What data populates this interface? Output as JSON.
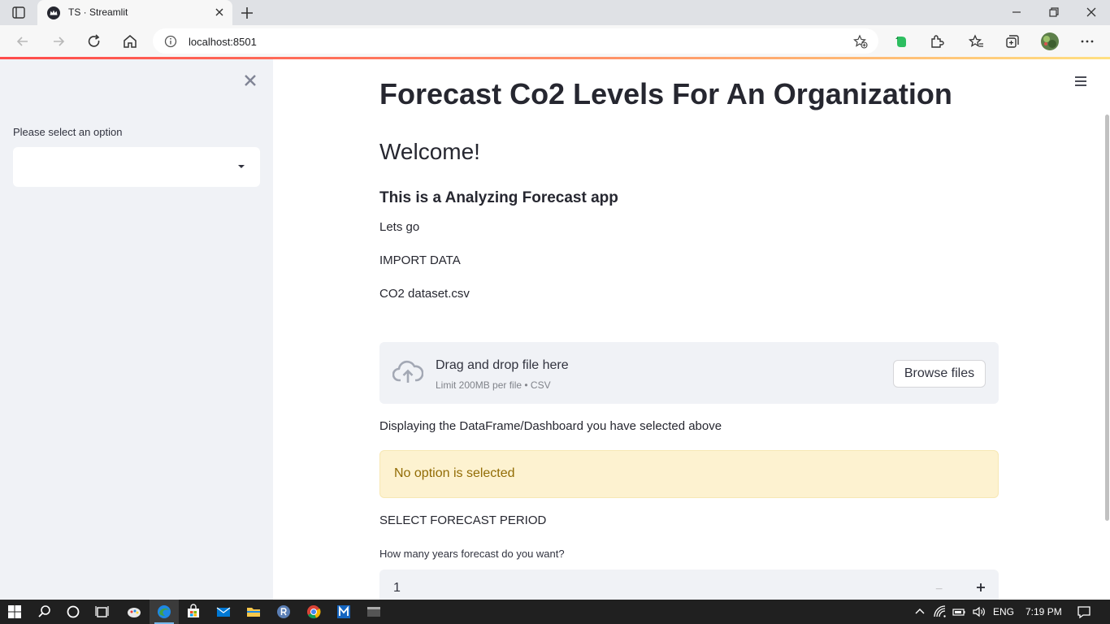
{
  "browser": {
    "tab_title": "TS · Streamlit",
    "url": "localhost:8501"
  },
  "sidebar": {
    "select_label": "Please select an option",
    "select_value": ""
  },
  "main": {
    "title": "Forecast Co2 Levels For An Organization",
    "welcome": "Welcome!",
    "subtitle": "This is a Analyzing Forecast app",
    "lets_go": "Lets go",
    "import_data": "IMPORT DATA",
    "dataset_name": "CO2 dataset.csv",
    "uploader": {
      "title": "Drag and drop file here",
      "hint": "Limit 200MB per file • CSV",
      "button": "Browse files"
    },
    "display_text": "Displaying the DataFrame/Dashboard you have selected above",
    "warning": "No option is selected",
    "forecast_header": "SELECT FORECAST PERIOD",
    "years_label": "How many years forecast do you want?",
    "years_value": "1",
    "minus": "−"
  },
  "taskbar": {
    "language": "ENG",
    "time": "7:19 PM"
  },
  "colors": {
    "sidebar_bg": "#f0f2f6",
    "warning_bg": "#fdf2d0",
    "warning_text": "#926c05",
    "accent": "#ff4b4b"
  }
}
